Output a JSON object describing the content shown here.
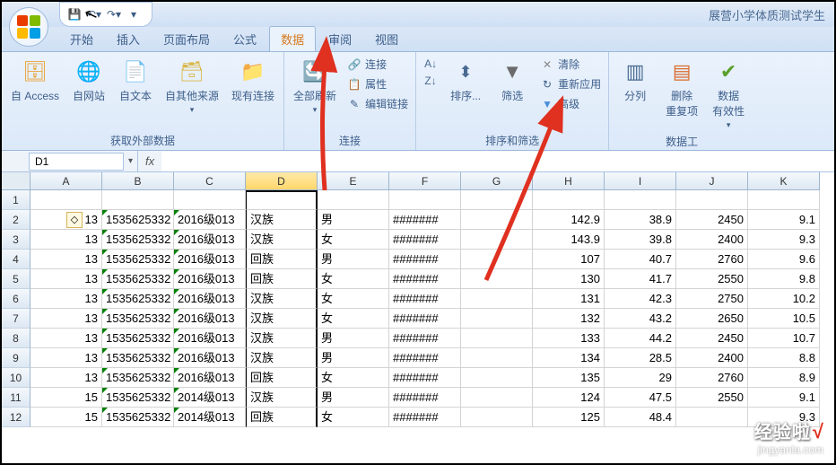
{
  "title": "展营小学体质测试学生",
  "qat": {
    "save": "save",
    "undo": "undo",
    "redo": "redo"
  },
  "tabs": {
    "items": [
      "开始",
      "插入",
      "页面布局",
      "公式",
      "数据",
      "审阅",
      "视图"
    ],
    "active_index": 4
  },
  "ribbon": {
    "group_get": {
      "label": "获取外部数据",
      "access": "自 Access",
      "web": "自网站",
      "text": "自文本",
      "other": "自其他来源",
      "existing": "现有连接"
    },
    "group_conn": {
      "label": "连接",
      "refresh": "全部刷新",
      "connections": "连接",
      "properties": "属性",
      "editlinks": "编辑链接"
    },
    "group_sort": {
      "label": "排序和筛选",
      "sort": "排序...",
      "filter": "筛选",
      "clear": "清除",
      "reapply": "重新应用",
      "advanced": "高级"
    },
    "group_tools": {
      "label": "数据工",
      "split": "分列",
      "dedup": "删除\n重复项",
      "validate": "数据\n有效性"
    }
  },
  "formula_bar": {
    "name": "D1",
    "fx": "fx",
    "value": ""
  },
  "columns": [
    "A",
    "B",
    "C",
    "D",
    "E",
    "F",
    "G",
    "H",
    "I",
    "J",
    "K"
  ],
  "selected_col_index": 3,
  "row_headers": [
    "1",
    "2",
    "3",
    "4",
    "5",
    "6",
    "7",
    "8",
    "9",
    "10",
    "11",
    "12"
  ],
  "table": [
    [
      "",
      "",
      "",
      "",
      "",
      "",
      "",
      "",
      "",
      "",
      ""
    ],
    [
      "13",
      "1535625332",
      "2016级013",
      "汉族",
      "男",
      "#######",
      "",
      "142.9",
      "38.9",
      "2450",
      "9.1"
    ],
    [
      "13",
      "1535625332",
      "2016级013",
      "汉族",
      "女",
      "#######",
      "",
      "143.9",
      "39.8",
      "2400",
      "9.3"
    ],
    [
      "13",
      "1535625332",
      "2016级013",
      "回族",
      "男",
      "#######",
      "",
      "107",
      "40.7",
      "2760",
      "9.6"
    ],
    [
      "13",
      "1535625332",
      "2016级013",
      "回族",
      "女",
      "#######",
      "",
      "130",
      "41.7",
      "2550",
      "9.8"
    ],
    [
      "13",
      "1535625332",
      "2016级013",
      "汉族",
      "女",
      "#######",
      "",
      "131",
      "42.3",
      "2750",
      "10.2"
    ],
    [
      "13",
      "1535625332",
      "2016级013",
      "汉族",
      "女",
      "#######",
      "",
      "132",
      "43.2",
      "2650",
      "10.5"
    ],
    [
      "13",
      "1535625332",
      "2016级013",
      "汉族",
      "男",
      "#######",
      "",
      "133",
      "44.2",
      "2450",
      "10.7"
    ],
    [
      "13",
      "1535625332",
      "2016级013",
      "汉族",
      "男",
      "#######",
      "",
      "134",
      "28.5",
      "2400",
      "8.8"
    ],
    [
      "13",
      "1535625332",
      "2016级013",
      "回族",
      "女",
      "#######",
      "",
      "135",
      "29",
      "2760",
      "8.9"
    ],
    [
      "15",
      "1535625332",
      "2014级013",
      "汉族",
      "男",
      "#######",
      "",
      "124",
      "47.5",
      "2550",
      "9.1"
    ],
    [
      "15",
      "1535625332",
      "2014级013",
      "回族",
      "女",
      "#######",
      "",
      "125",
      "48.4",
      "",
      "9.3"
    ]
  ],
  "text_cols": [
    1,
    2,
    3,
    4,
    5
  ],
  "green_tri_cols": [
    1,
    2
  ],
  "watermark": {
    "main": "经验啦",
    "sub": "jingyanla.com"
  },
  "chart_data": null
}
